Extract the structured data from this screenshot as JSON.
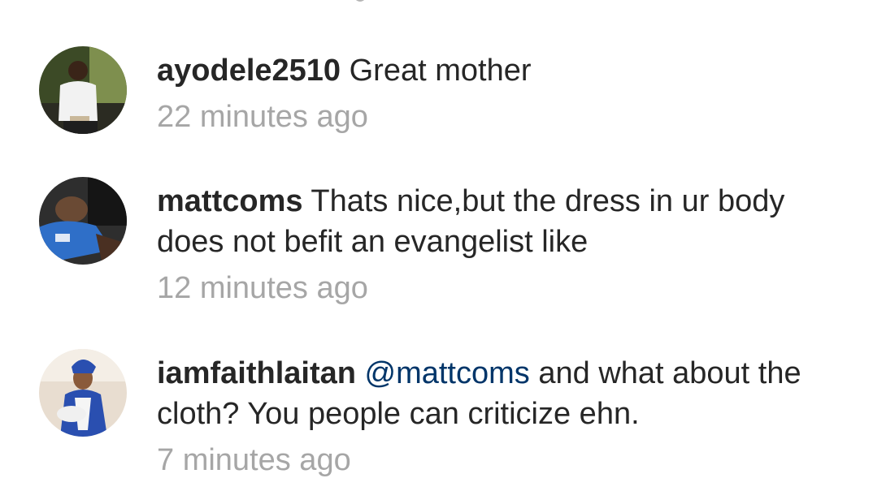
{
  "comments": [
    {
      "username": "ayodele2510",
      "mention": "",
      "text": "Great mother",
      "time": "22 minutes ago",
      "avatar_icon": "user-avatar-photo"
    },
    {
      "username": "mattcoms",
      "mention": "",
      "text": "Thats nice,but the dress in ur body does not befit an evangelist like",
      "time": "12 minutes ago",
      "avatar_icon": "user-avatar-photo"
    },
    {
      "username": "iamfaithlaitan",
      "mention": "@mattcoms",
      "text": "and what about the cloth? You people can criticize ehn.",
      "time": "7 minutes ago",
      "avatar_icon": "user-avatar-photo"
    }
  ],
  "colors": {
    "text": "#262626",
    "mention": "#003569",
    "timestamp": "#a6a6a6",
    "background": "#ffffff"
  }
}
